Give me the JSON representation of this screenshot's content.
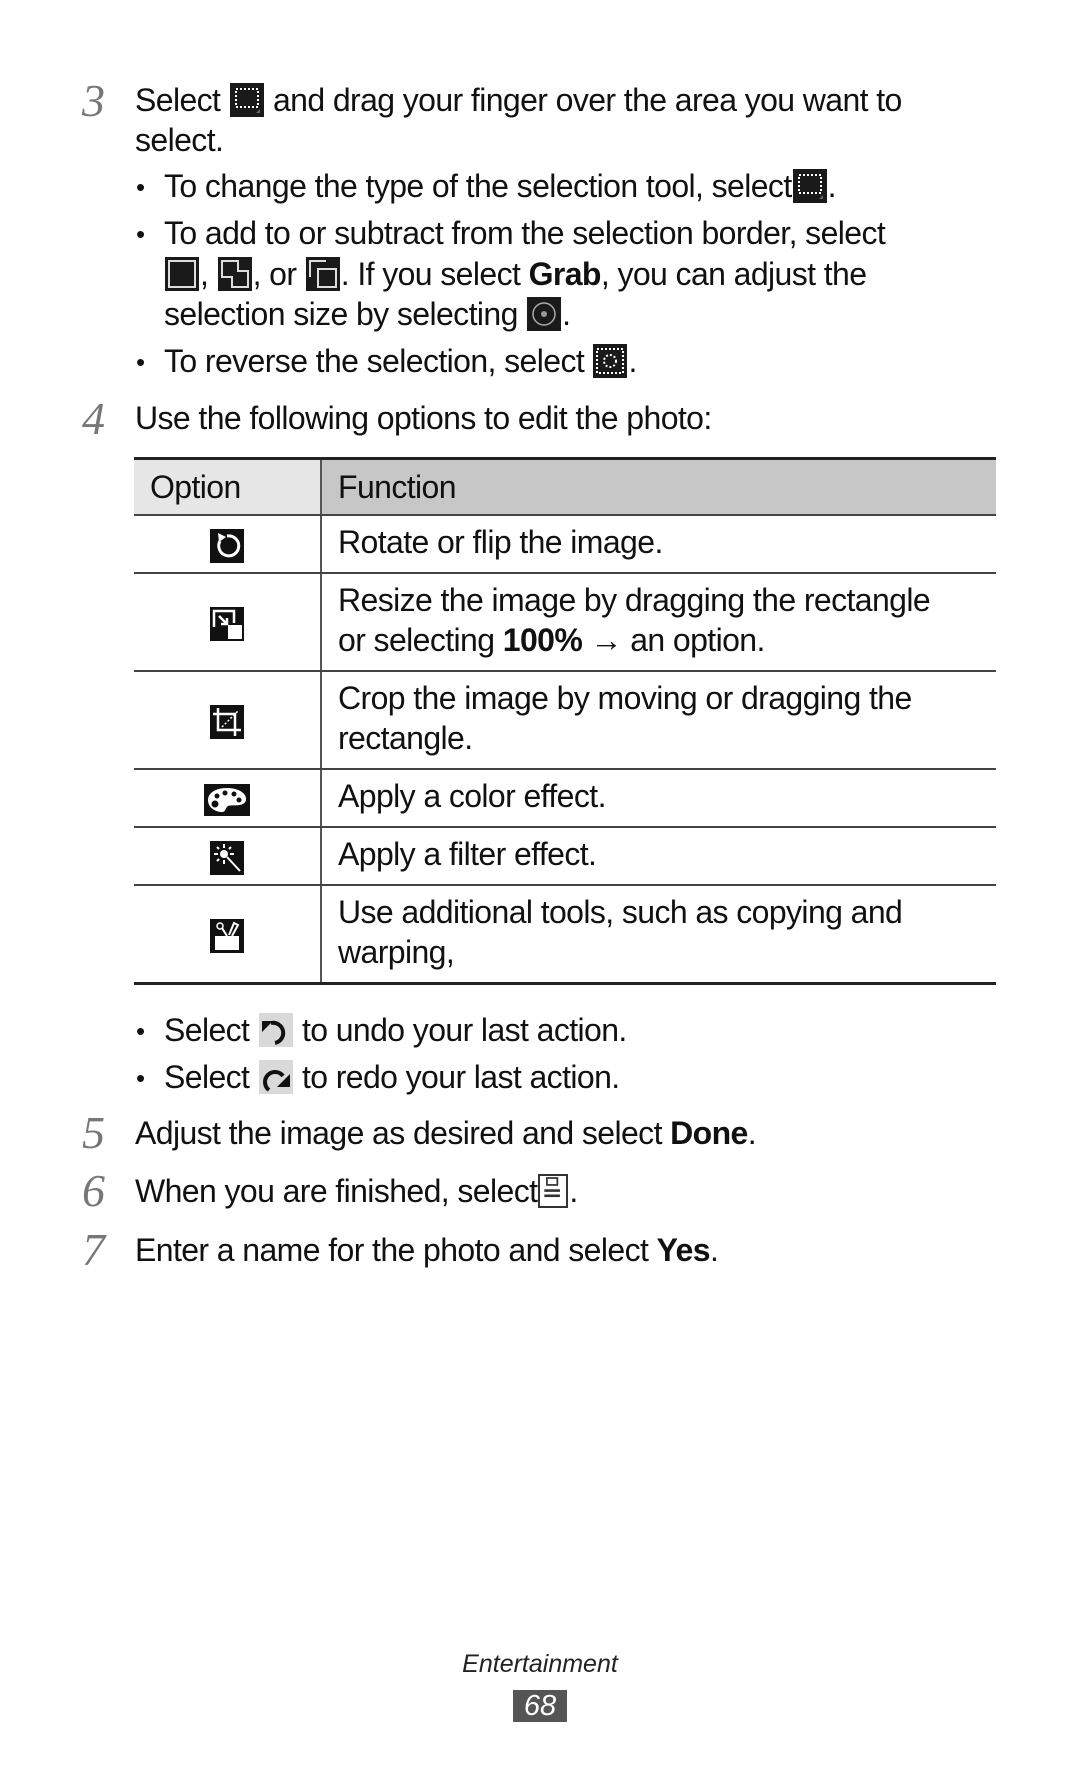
{
  "steps": {
    "s3": {
      "number": "3",
      "text_a": "Select",
      "icon": "marquee-select-icon",
      "text_b": "and drag your finger over the area you want to",
      "text_c": "select.",
      "bullets": [
        {
          "text_a": "To change the type of the selection tool, select",
          "icon": "selection-type-icon",
          "text_b": "."
        },
        {
          "text_a": "To add to or subtract from the selection border, select",
          "line2_a": ",",
          "line2_b": ", or",
          "line2_c": ". If you select",
          "bold": "Grab",
          "line2_d": ", you can adjust the",
          "line3": "selection size by selecting",
          "line3_end": ".",
          "icons": [
            "new-selection-icon",
            "add-selection-icon",
            "subtract-selection-icon",
            "grab-handle-icon"
          ]
        },
        {
          "text_a": "To reverse the selection, select",
          "icon": "invert-selection-icon",
          "text_b": "."
        }
      ]
    },
    "s4": {
      "number": "4",
      "text": "Use the following options to edit the photo:"
    },
    "undo": {
      "text_a": "Select",
      "text_b": "to undo your last action.",
      "icon": "undo-icon"
    },
    "redo": {
      "text_a": "Select",
      "text_b": "to redo your last action.",
      "icon": "redo-icon"
    },
    "s5": {
      "number": "5",
      "text": "Adjust the image as desired and select",
      "bold": "Done",
      "end": "."
    },
    "s6": {
      "number": "6",
      "text": "When you are finished, select",
      "icon": "save-icon",
      "end": "."
    },
    "s7": {
      "number": "7",
      "text": "Enter a name for the photo and select",
      "bold": "Yes",
      "end": "."
    }
  },
  "table": {
    "headers": [
      "Option",
      "Function"
    ],
    "rows": [
      {
        "icon": "rotate-icon",
        "function": "Rotate or flip the image."
      },
      {
        "icon": "resize-icon",
        "function_a": "Resize the image by dragging the rectangle",
        "function_b": "or selecting",
        "bold": "100%",
        "arrow": "→",
        "function_c": "an option."
      },
      {
        "icon": "crop-icon",
        "function_a": "Crop the image by moving or dragging the",
        "function_b": "rectangle."
      },
      {
        "icon": "palette-icon",
        "function": "Apply a color effect."
      },
      {
        "icon": "magic-wand-icon",
        "function": "Apply a filter effect."
      },
      {
        "icon": "tools-icon",
        "function_a": "Use additional tools, such as copying and",
        "function_b": "warping,"
      }
    ]
  },
  "footer": {
    "section": "Entertainment",
    "page": "68"
  },
  "colors": {
    "step_number": "#777777",
    "header_option_bg": "#e6e6e6",
    "header_function_bg": "#c7c7c7",
    "page_badge_bg": "#555555"
  }
}
